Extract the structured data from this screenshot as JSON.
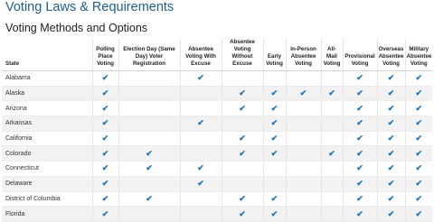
{
  "page_title": "Voting Laws & Requirements",
  "section_title": "Voting Methods and Options",
  "columns": [
    "State",
    "Polling Place Voting",
    "Election Day (Same Day) Voter Registration",
    "Absentee Voting With Excuse",
    "Absentee Voting Without Excuse",
    "Early Voting",
    "In-Person Absentee Voting",
    "All-Mail Voting",
    "Provisional Voting",
    "Overseas Absentee Voting",
    "Military Absentee Voting"
  ],
  "check_icon": "check-icon",
  "accent_color": "#1d72b8",
  "rows": [
    {
      "state": "Alabama",
      "flags": [
        1,
        0,
        1,
        0,
        0,
        0,
        0,
        1,
        1,
        1
      ]
    },
    {
      "state": "Alaska",
      "flags": [
        1,
        0,
        0,
        1,
        1,
        1,
        1,
        1,
        1,
        1
      ]
    },
    {
      "state": "Arizona",
      "flags": [
        1,
        0,
        0,
        1,
        1,
        0,
        0,
        1,
        1,
        1
      ]
    },
    {
      "state": "Arkansas",
      "flags": [
        1,
        0,
        1,
        0,
        1,
        0,
        0,
        1,
        1,
        1
      ]
    },
    {
      "state": "California",
      "flags": [
        1,
        0,
        0,
        1,
        1,
        0,
        0,
        1,
        1,
        1
      ]
    },
    {
      "state": "Colorado",
      "flags": [
        1,
        1,
        0,
        1,
        1,
        0,
        1,
        1,
        1,
        1
      ]
    },
    {
      "state": "Connecticut",
      "flags": [
        1,
        1,
        1,
        0,
        0,
        0,
        0,
        1,
        1,
        1
      ]
    },
    {
      "state": "Delaware",
      "flags": [
        1,
        0,
        1,
        0,
        0,
        0,
        0,
        1,
        1,
        1
      ]
    },
    {
      "state": "District of Columbia",
      "flags": [
        1,
        1,
        0,
        1,
        1,
        0,
        0,
        1,
        1,
        1
      ]
    },
    {
      "state": "Florida",
      "flags": [
        1,
        0,
        0,
        1,
        1,
        0,
        0,
        1,
        1,
        1
      ]
    }
  ]
}
